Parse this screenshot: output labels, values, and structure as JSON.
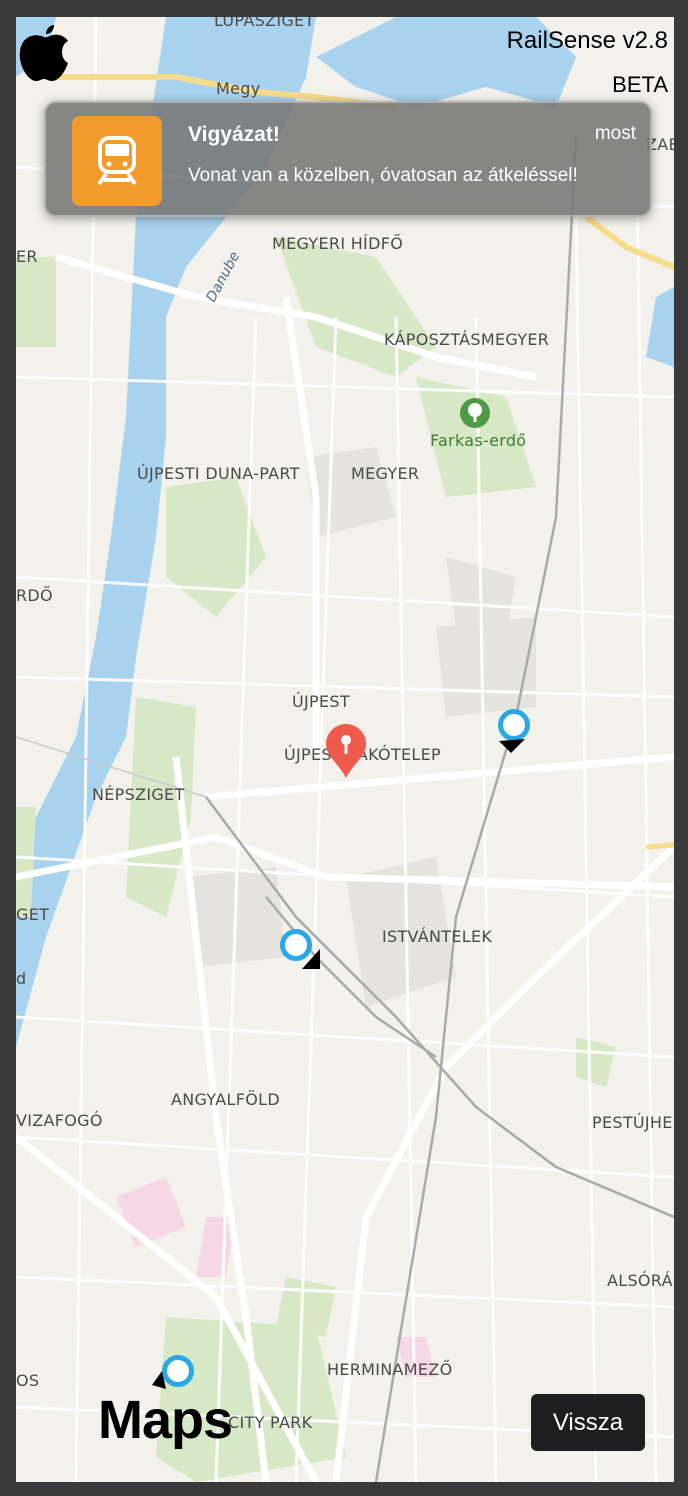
{
  "app": {
    "title": "RailSense v2.8",
    "badge": "BETA"
  },
  "notification": {
    "title": "Vigyázat!",
    "time": "most",
    "message": "Vonat van a közelben, óvatosan az átkeléssel!",
    "icon": "train-icon",
    "icon_color": "#f39a2c"
  },
  "map": {
    "labels": {
      "lupasziget": "LUPASZIGET",
      "megyeri_road": "Megy",
      "zab": "ZAB",
      "er": "ER",
      "danube": "Danube",
      "megyeri_hid": "MEGYERI HÍDFŐ",
      "kaposztasmegyer": "KÁPOSZTÁSMEGYER",
      "farkas_erdo": "Farkas-erdő",
      "ujpesti_duna_part": "ÚJPESTI DUNA-PART",
      "megyer": "MEGYER",
      "rdo": "RDŐ",
      "ujpest": "ÚJPEST",
      "ujpest_lakotelep": "ÚJPEST LAKÓTELEP",
      "nepsziget": "NÉPSZIGET",
      "get": "GET",
      "d": "d",
      "istvantelek": "ISTVÁNTELEK",
      "vizafogo": "VIZAFOGÓ",
      "angyalfold": "ANGYALFÖLD",
      "pestujhe": "PESTÚJHE",
      "alsora": "ALSÓRÁ",
      "os": "OS",
      "herminamezo": "HERMINAMEZŐ",
      "city_park": "CITY PARK"
    },
    "colors": {
      "water": "#a8d2ee",
      "park": "#d7e8c7",
      "marker": "#2aa8e6",
      "pin": "#ef5a4c"
    }
  },
  "footer": {
    "logo": "Maps",
    "back_label": "Vissza"
  }
}
